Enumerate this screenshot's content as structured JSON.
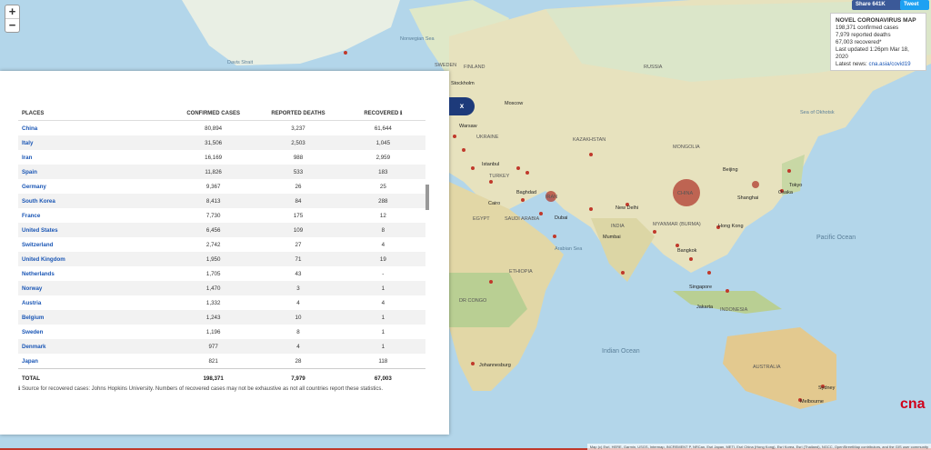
{
  "zoom": {
    "in": "+",
    "out": "−"
  },
  "share": {
    "facebook": "Share 641K",
    "twitter": "Tweet"
  },
  "info": {
    "title": "NOVEL CORONAVIRUS MAP",
    "confirmed": "198,371 confirmed cases",
    "deaths": "7,979 reported deaths",
    "recovered": "67,003 recovered*",
    "updated": "Last updated 1:26pm Mar 18, 2020",
    "news_label": "Latest news:",
    "news_link": "cna.asia/covid19"
  },
  "table": {
    "headers": [
      "PLACES",
      "CONFIRMED CASES",
      "REPORTED DEATHS",
      "RECOVERED ℹ"
    ],
    "rows": [
      [
        "China",
        "80,894",
        "3,237",
        "61,644"
      ],
      [
        "Italy",
        "31,506",
        "2,503",
        "1,045"
      ],
      [
        "Iran",
        "16,169",
        "988",
        "2,959"
      ],
      [
        "Spain",
        "11,826",
        "533",
        "183"
      ],
      [
        "Germany",
        "9,367",
        "26",
        "25"
      ],
      [
        "South Korea",
        "8,413",
        "84",
        "288"
      ],
      [
        "France",
        "7,730",
        "175",
        "12"
      ],
      [
        "United States",
        "6,456",
        "109",
        "8"
      ],
      [
        "Switzerland",
        "2,742",
        "27",
        "4"
      ],
      [
        "United Kingdom",
        "1,950",
        "71",
        "19"
      ],
      [
        "Netherlands",
        "1,705",
        "43",
        "-"
      ],
      [
        "Norway",
        "1,470",
        "3",
        "1"
      ],
      [
        "Austria",
        "1,332",
        "4",
        "4"
      ],
      [
        "Belgium",
        "1,243",
        "10",
        "1"
      ],
      [
        "Sweden",
        "1,196",
        "8",
        "1"
      ],
      [
        "Denmark",
        "977",
        "4",
        "1"
      ],
      [
        "Japan",
        "821",
        "28",
        "118"
      ]
    ],
    "total": [
      "TOTAL",
      "198,371",
      "7,979",
      "67,003"
    ]
  },
  "note": "ℹ Source for recovered cases: Johns Hopkins University. Numbers of recovered cases may not be exhaustive as not all countries report these statistics.",
  "close_label": "x",
  "logo": "cna",
  "attribution": "Map (c) Esri, HERE, Garmin, USGS, Intermap, INCREMENT P, NRCan, Esri Japan, METI, Esri China (Hong Kong), Esri Korea, Esri (Thailand), NGCC, OpenStreetMap contributors, and the GIS user community",
  "map_labels": {
    "davis_strait": "Davis Strait",
    "norwegian_sea": "Norwegian Sea",
    "sweden": "SWEDEN",
    "finland": "FINLAND",
    "stockholm": "Stockholm",
    "russia": "RUSSIA",
    "moscow": "Moscow",
    "warsaw": "Warsaw",
    "ukraine": "UKRAINE",
    "kazakhstan": "KAZAKHSTAN",
    "mongolia": "MONGOLIA",
    "sea_of_okhotsk": "Sea of Okhotsk",
    "istanbul": "Istanbul",
    "turkey": "TURKEY",
    "beijing": "Beijing",
    "china": "CHINA",
    "tokyo": "Tokyo",
    "osaka": "Osaka",
    "shanghai": "Shanghai",
    "baghdad": "Baghdad",
    "iran": "IRAN",
    "cairo": "Cairo",
    "egypt": "EGYPT",
    "saudi_arabia": "SAUDI ARABIA",
    "dubai": "Dubai",
    "new_delhi": "New Delhi",
    "india": "INDIA",
    "myanmar": "MYANMAR (BURMA)",
    "hong_kong": "Hong Kong",
    "pacific_ocean": "Pacific Ocean",
    "arabian_sea": "Arabian Sea",
    "mumbai": "Mumbai",
    "bangkok": "Bangkok",
    "ethiopia": "ETHIOPIA",
    "dr_congo": "DR CONGO",
    "singapore": "Singapore",
    "jakarta": "Jakarta",
    "indonesia": "INDONESIA",
    "indian_ocean": "Indian Ocean",
    "johannesburg": "Johannesburg",
    "australia": "AUSTRALIA",
    "sydney": "Sydney",
    "melbourne": "Melbourne"
  }
}
